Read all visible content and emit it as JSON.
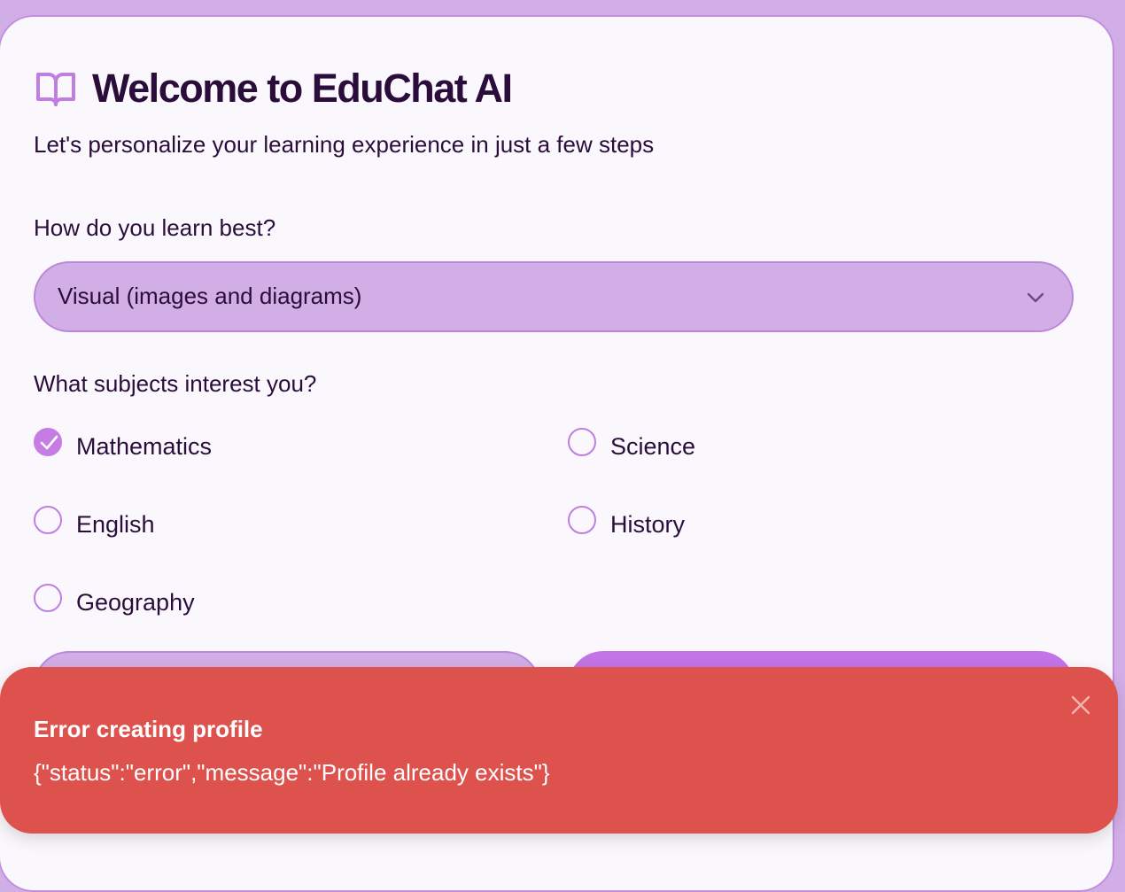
{
  "header": {
    "icon": "book-open-icon",
    "title": "Welcome to EduChat AI",
    "subtitle": "Let's personalize your learning experience in just a few steps"
  },
  "learning_style": {
    "label": "How do you learn best?",
    "selected": "Visual (images and diagrams)"
  },
  "subjects": {
    "label": "What subjects interest you?",
    "options": [
      {
        "label": "Mathematics",
        "checked": true
      },
      {
        "label": "Science",
        "checked": false
      },
      {
        "label": "English",
        "checked": false
      },
      {
        "label": "History",
        "checked": false
      },
      {
        "label": "Geography",
        "checked": false
      }
    ]
  },
  "toast": {
    "title": "Error creating profile",
    "message": "{\"status\":\"error\",\"message\":\"Profile already exists\"}",
    "close_icon": "close-icon"
  },
  "colors": {
    "background": "#d2aee6",
    "card": "#fbf8fd",
    "accent": "#c474e6",
    "error": "#de524e",
    "text": "#2a0d3a"
  }
}
